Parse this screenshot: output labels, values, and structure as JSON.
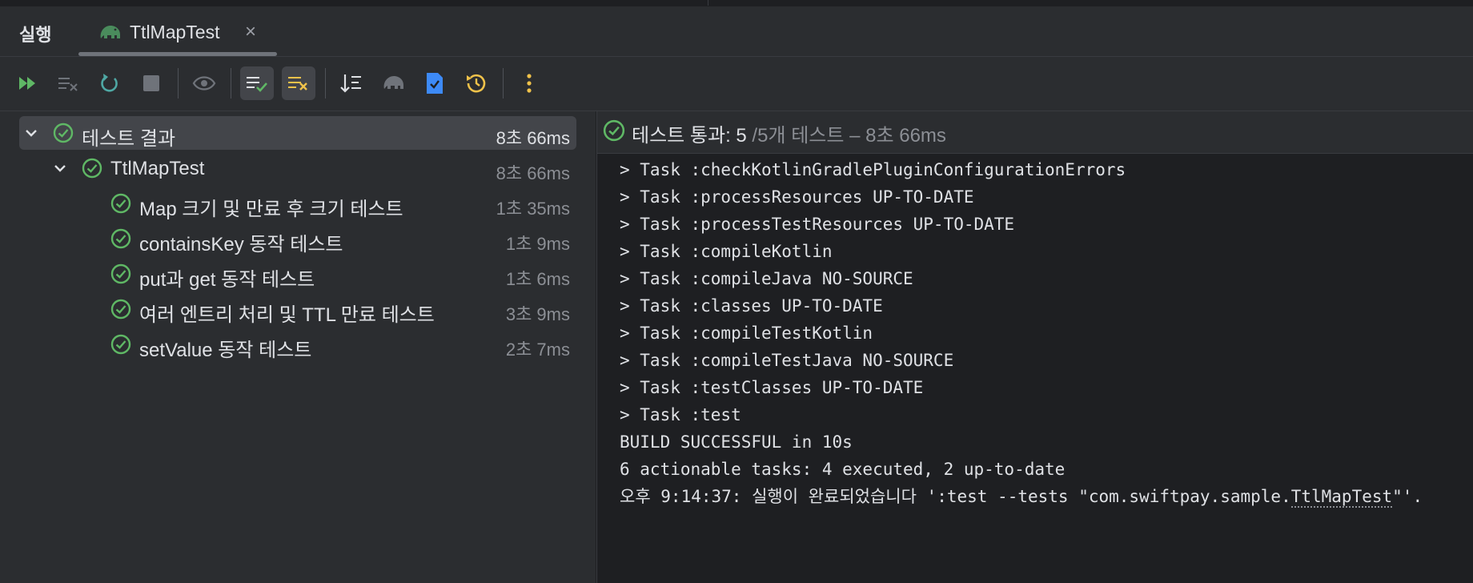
{
  "tabbar": {
    "run_label": "실행",
    "tab_title": "TtlMapTest",
    "close_glyph": "×"
  },
  "toolbar": {
    "buttons": [
      {
        "icon": "rerun-failed-icon",
        "active": false
      },
      {
        "icon": "clear-list-icon",
        "active": false
      },
      {
        "icon": "rerun-icon",
        "active": false
      },
      {
        "icon": "stop-icon",
        "active": false
      },
      {
        "icon": "eye-icon",
        "active": false
      },
      {
        "icon": "show-passed-icon",
        "active": true
      },
      {
        "icon": "show-ignored-icon",
        "active": true
      },
      {
        "icon": "sort-icon",
        "active": false
      },
      {
        "icon": "gradle-icon",
        "active": false
      },
      {
        "icon": "export-icon",
        "active": false
      },
      {
        "icon": "history-icon",
        "active": false
      },
      {
        "icon": "more-icon",
        "active": false
      }
    ]
  },
  "tree": {
    "root": {
      "name": "테스트 결과",
      "time": "8초 66ms"
    },
    "suite": {
      "name": "TtlMapTest",
      "time": "8초 66ms"
    },
    "tests": [
      {
        "name": "Map 크기 및 만료 후 크기 테스트",
        "time": "1초 35ms"
      },
      {
        "name": "containsKey 동작 테스트",
        "time": "1초 9ms"
      },
      {
        "name": "put과 get 동작 테스트",
        "time": "1초 6ms"
      },
      {
        "name": "여러 엔트리 처리 및 TTL 만료 테스트",
        "time": "3초 9ms"
      },
      {
        "name": "setValue 동작 테스트",
        "time": "2초 7ms"
      }
    ]
  },
  "result": {
    "passed_label": "테스트 통과: 5",
    "total_label": " /5개 테스트 – 8초 66ms"
  },
  "console": {
    "lines": [
      "> Task :checkKotlinGradlePluginConfigurationErrors",
      "> Task :processResources UP-TO-DATE",
      "> Task :processTestResources UP-TO-DATE",
      "> Task :compileKotlin",
      "> Task :compileJava NO-SOURCE",
      "> Task :classes UP-TO-DATE",
      "> Task :compileTestKotlin",
      "> Task :compileTestJava NO-SOURCE",
      "> Task :testClasses UP-TO-DATE",
      "> Task :test",
      "BUILD SUCCESSFUL in 10s",
      "6 actionable tasks: 4 executed, 2 up-to-date"
    ],
    "last_line_prefix": "오후 9:14:37: 실행이 완료되었습니다 ':test --tests \"com.swiftpay.sample.",
    "last_line_link": "TtlMapTest",
    "last_line_suffix": "\"'."
  },
  "colors": {
    "pass_green": "#5fb865",
    "accent_blue": "#3d8af7",
    "warn_yellow": "#f0c24a"
  }
}
